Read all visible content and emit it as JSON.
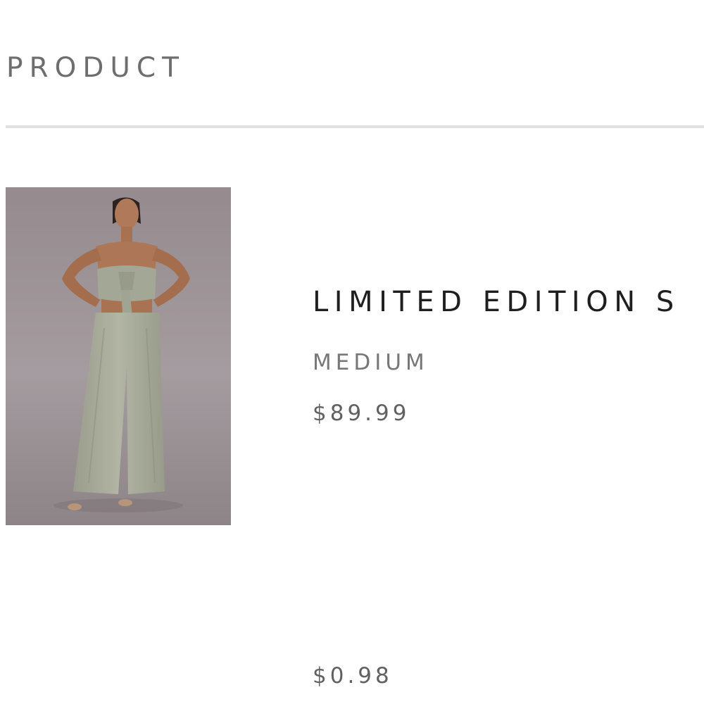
{
  "header": {
    "title": "PRODUCT"
  },
  "product": {
    "name": "LIMITED EDITION S",
    "variant": "MEDIUM",
    "price": "$89.99",
    "image_alt": "Woman wearing a sage strapless tie-front top and wide-leg pants"
  },
  "summary": {
    "price": "$0.98"
  },
  "colors": {
    "header_text": "#6e6e6e",
    "divider": "#e1e1e1",
    "outfit": "#a9ad9c",
    "photo_background": "#9b9194"
  }
}
